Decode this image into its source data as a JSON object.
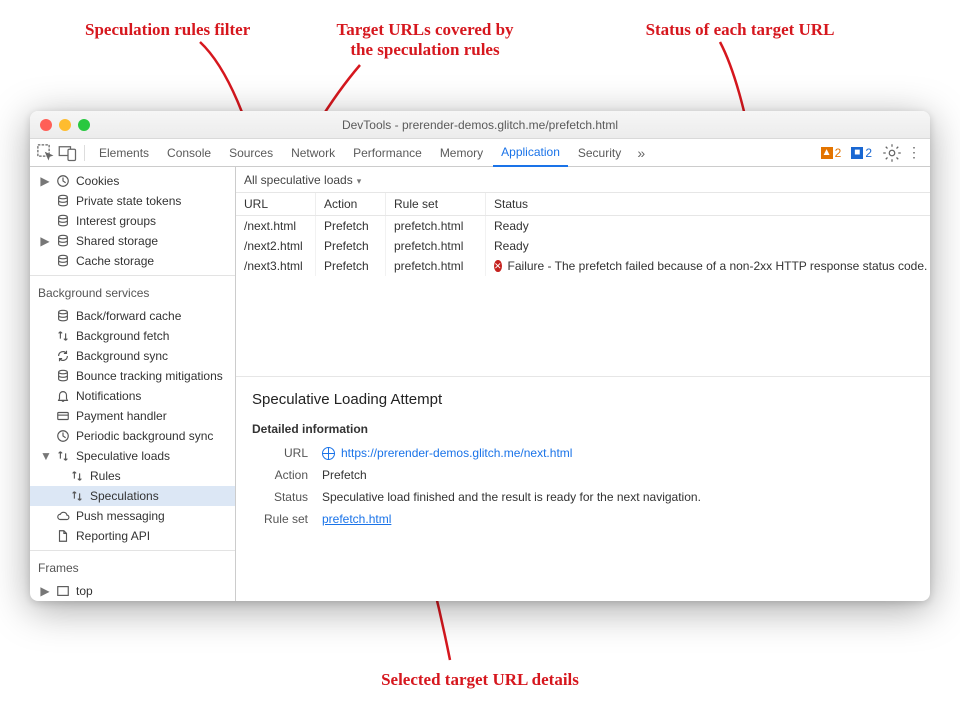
{
  "annotations": {
    "filter": "Speculation rules filter",
    "targets": "Target URLs covered by\nthe speculation rules",
    "status": "Status of each target URL",
    "details": "Selected target URL details"
  },
  "window": {
    "title": "DevTools - prerender-demos.glitch.me/prefetch.html"
  },
  "toolbar": {
    "tabs": [
      "Elements",
      "Console",
      "Sources",
      "Network",
      "Performance",
      "Memory",
      "Application",
      "Security"
    ],
    "active_tab": "Application",
    "warnings_count": "2",
    "info_count": "2"
  },
  "sidebar": {
    "groups": [
      {
        "items": [
          {
            "label": "Cookies",
            "icon": "clock",
            "expandable": true
          },
          {
            "label": "Private state tokens",
            "icon": "db"
          },
          {
            "label": "Interest groups",
            "icon": "db"
          },
          {
            "label": "Shared storage",
            "icon": "db",
            "expandable": true
          },
          {
            "label": "Cache storage",
            "icon": "db"
          }
        ]
      },
      {
        "title": "Background services",
        "items": [
          {
            "label": "Back/forward cache",
            "icon": "db"
          },
          {
            "label": "Background fetch",
            "icon": "updown"
          },
          {
            "label": "Background sync",
            "icon": "sync"
          },
          {
            "label": "Bounce tracking mitigations",
            "icon": "db"
          },
          {
            "label": "Notifications",
            "icon": "bell"
          },
          {
            "label": "Payment handler",
            "icon": "card"
          },
          {
            "label": "Periodic background sync",
            "icon": "clock"
          },
          {
            "label": "Speculative loads",
            "icon": "updown",
            "expandable": true,
            "expanded": true,
            "children": [
              {
                "label": "Rules",
                "icon": "updown"
              },
              {
                "label": "Speculations",
                "icon": "updown",
                "selected": true
              }
            ]
          },
          {
            "label": "Push messaging",
            "icon": "cloud"
          },
          {
            "label": "Reporting API",
            "icon": "file"
          }
        ]
      },
      {
        "title": "Frames",
        "items": [
          {
            "label": "top",
            "icon": "frame",
            "expandable": true
          }
        ]
      }
    ]
  },
  "filter": {
    "label": "All speculative loads"
  },
  "table": {
    "columns": [
      "URL",
      "Action",
      "Rule set",
      "Status"
    ],
    "rows": [
      {
        "url": "/next.html",
        "action": "Prefetch",
        "ruleset": "prefetch.html",
        "status": "Ready"
      },
      {
        "url": "/next2.html",
        "action": "Prefetch",
        "ruleset": "prefetch.html",
        "status": "Ready"
      },
      {
        "url": "/next3.html",
        "action": "Prefetch",
        "ruleset": "prefetch.html",
        "status_fail": "Failure - The prefetch failed because of a non-2xx HTTP response status code."
      }
    ]
  },
  "details": {
    "heading": "Speculative Loading Attempt",
    "subheading": "Detailed information",
    "url_label": "URL",
    "url": "https://prerender-demos.glitch.me/next.html",
    "action_label": "Action",
    "action": "Prefetch",
    "status_label": "Status",
    "status": "Speculative load finished and the result is ready for the next navigation.",
    "ruleset_label": "Rule set",
    "ruleset": "prefetch.html"
  }
}
